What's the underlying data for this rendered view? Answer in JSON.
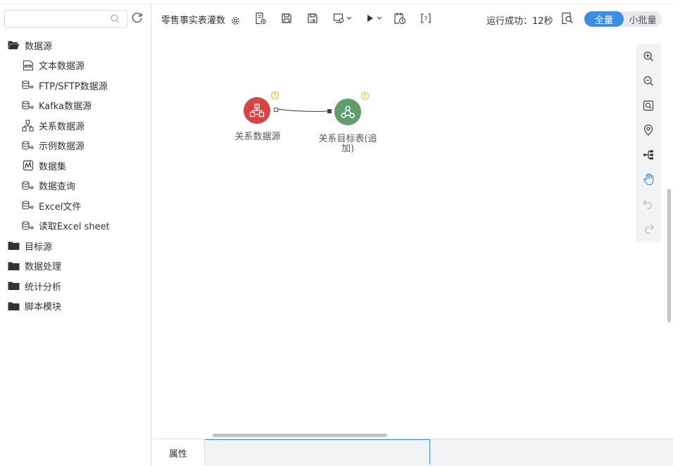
{
  "search": {
    "placeholder": ""
  },
  "tree": {
    "folders": [
      {
        "label": "数据源",
        "open": true
      },
      {
        "label": "目标源"
      },
      {
        "label": "数据处理"
      },
      {
        "label": "统计分析"
      },
      {
        "label": "脚本模块"
      }
    ],
    "items": [
      {
        "label": "文本数据源",
        "icon": "tds-file-icon"
      },
      {
        "label": "FTP/SFTP数据源",
        "icon": "database-link-icon"
      },
      {
        "label": "Kafka数据源",
        "icon": "database-link-icon"
      },
      {
        "label": "关系数据源",
        "icon": "relational-db-icon"
      },
      {
        "label": "示例数据源",
        "icon": "database-link-icon"
      },
      {
        "label": "数据集",
        "icon": "dataset-icon"
      },
      {
        "label": "数据查询",
        "icon": "database-link-icon"
      },
      {
        "label": "Excel文件",
        "icon": "database-link-icon"
      },
      {
        "label": "读取Excel sheet",
        "icon": "database-link-icon"
      }
    ]
  },
  "toolbar": {
    "title": "零售事实表灌数",
    "status": "运行成功：12秒",
    "toggle": {
      "active": "全量",
      "inactive": "小批量"
    }
  },
  "canvas": {
    "nodes": [
      {
        "label": "关系数据源",
        "color": "#d94343",
        "icon": "relational-db-icon"
      },
      {
        "label": "关系目标表(追加)",
        "color": "#5d9e6a",
        "icon": "target-hub-icon"
      }
    ],
    "warn_mark": "!"
  },
  "bottom": {
    "tab_label": "属性"
  },
  "colors": {
    "accent": "#3a8ee6",
    "warning": "#f0b72c"
  }
}
